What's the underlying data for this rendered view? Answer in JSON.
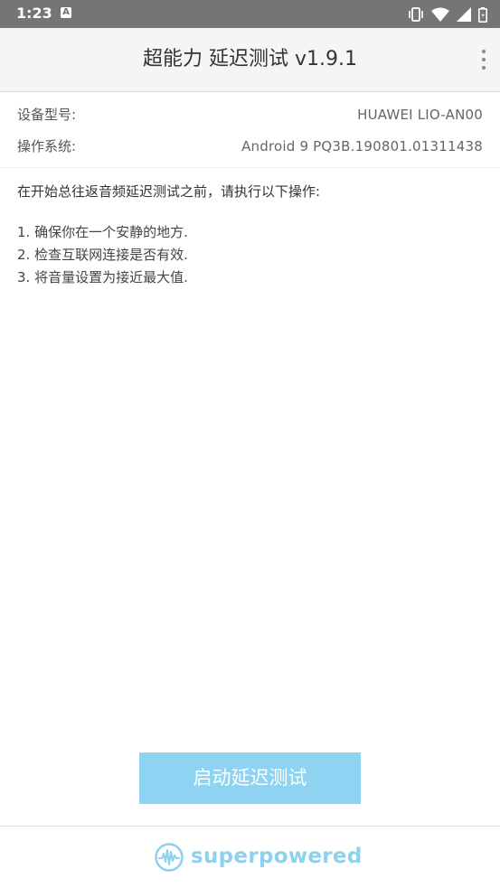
{
  "status_bar": {
    "time": "1:23",
    "notification_icon": "a-icon",
    "icons": [
      "vibrate-icon",
      "wifi-icon",
      "signal-icon",
      "battery-icon"
    ]
  },
  "toolbar": {
    "title": "超能力 延迟测试 v1.9.1",
    "menu_icon": "overflow-menu-icon"
  },
  "device_info": {
    "model_label": "设备型号:",
    "model_value": "HUAWEI LIO-AN00",
    "os_label": "操作系统:",
    "os_value": "Android 9 PQ3B.190801.01311438"
  },
  "instructions": {
    "intro": "在开始总往返音频延迟测试之前，请执行以下操作:",
    "steps": [
      "1. 确保你在一个安静的地方.",
      "2. 检查互联网连接是否有效.",
      "3. 将音量设置为接近最大值."
    ]
  },
  "start_button": {
    "label": "启动延迟测试"
  },
  "footer": {
    "brand": "superpowered",
    "logo_icon": "superpowered-logo-icon"
  },
  "colors": {
    "status_bar": "#757575",
    "toolbar": "#f5f5f5",
    "button": "#8fd3f2",
    "brand": "#8ed1ef"
  }
}
